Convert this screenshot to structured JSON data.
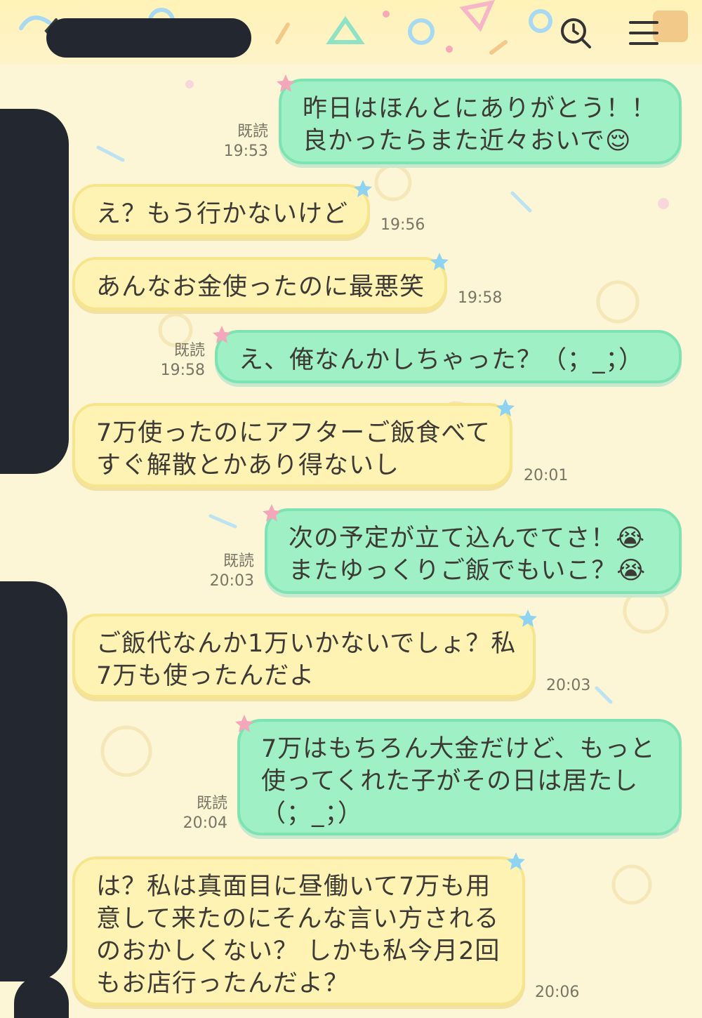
{
  "header": {
    "back_icon": "chevron-left-icon",
    "search_icon": "search-history-icon",
    "menu_icon": "hamburger-menu-icon"
  },
  "colors": {
    "outgoing_bubble": "#9ff0c4",
    "incoming_bubble": "#fff3b4",
    "background": "#fdf6d6",
    "redaction": "#23272f"
  },
  "messages": [
    {
      "side": "out",
      "lines": [
        "昨日はほんとにありがとう！！",
        "良かったらまた近々おいで😌"
      ],
      "read": "既読",
      "time": "19:53"
    },
    {
      "side": "in",
      "lines": [
        "え？もう行かないけど"
      ],
      "time": "19:56"
    },
    {
      "side": "in",
      "lines": [
        "あんなお金使ったのに最悪笑"
      ],
      "time": "19:58"
    },
    {
      "side": "out",
      "lines": [
        "え、俺なんかしちゃった？（；_；）"
      ],
      "read": "既読",
      "time": "19:58"
    },
    {
      "side": "in",
      "lines": [
        "7万使ったのにアフターご飯食べて",
        "すぐ解散とかあり得ないし"
      ],
      "time": "20:01"
    },
    {
      "side": "out",
      "lines": [
        "次の予定が立て込んでてさ！😭",
        "またゆっくりご飯でもいこ？😭"
      ],
      "read": "既読",
      "time": "20:03"
    },
    {
      "side": "in",
      "lines": [
        "ご飯代なんか1万いかないでしょ？私",
        "7万も使ったんだよ"
      ],
      "time": "20:03"
    },
    {
      "side": "out",
      "lines": [
        "7万はもちろん大金だけど、もっと",
        "使ってくれた子がその日は居たし",
        "（；_；）"
      ],
      "read": "既読",
      "time": "20:04"
    },
    {
      "side": "in",
      "lines": [
        "は？私は真面目に昼働いて7万も用",
        "意して来たのにそんな言い方される",
        "のおかしくない？ しかも私今月2回",
        "もお店行ったんだよ？"
      ],
      "time": "20:06"
    }
  ]
}
